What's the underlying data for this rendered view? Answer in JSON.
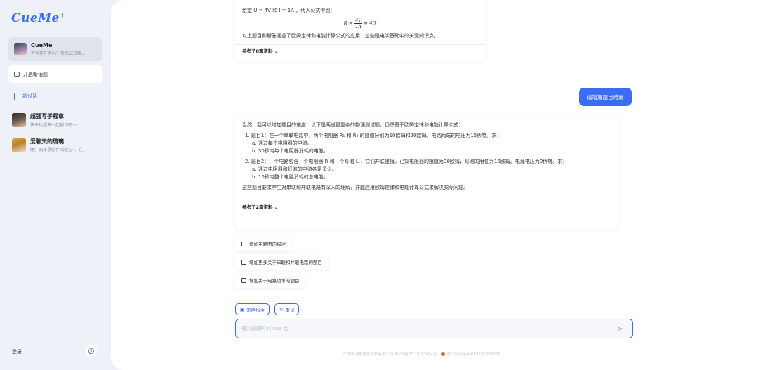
{
  "sidebar": {
    "logo": "CueMe",
    "logo_plus": "+",
    "active_agent": {
      "name": "CueMe",
      "desc": "有写作任务吗？快来试试我..."
    },
    "new_chat_label": "开启新话题",
    "new_conversation_label": "新对话",
    "agents": [
      {
        "name": "超强写手程章",
        "desc": "快来找程章一起创作吧～"
      },
      {
        "name": "爱聊天的琉璃",
        "desc": "嘿？刚才是你在叫我么～（..."
      }
    ],
    "login_label": "登录",
    "info_icon": "ⓘ"
  },
  "chat": {
    "msg1": {
      "top_line": "给定 U = 4V 和 I = 1A ，代入公式得到：",
      "formula_lhs": "R =",
      "formula_num": "4V",
      "formula_den": "1A",
      "formula_rhs": "= 4Ω",
      "summary": "以上题目和解答涵盖了欧姆定律和电能计算公式的应用，这些是电学基础中的关键知识点。",
      "ref": "参考了8篇资料 ⌄"
    },
    "user_msg": "请增加题目难度",
    "msg2": {
      "intro": "当然，我可以增加题目的难度，以下是两道更复杂的物理测试题，仍然基于欧姆定律和电能计算公式：",
      "q1": "1. 题目1：在一个串联电路中，两个电阻器 R₁ 和 R₂ 的阻值分别为10欧姆和20欧姆。电路两端的电压为15伏特。求：",
      "q1a": "a. 通过每个电阻器的电流。",
      "q1b": "b. 30秒内每个电阻器消耗的电能。",
      "q2": "2. 题目2：一个电路包含一个电阻器 R 和一个灯泡 L ，它们并联连接。已知电阻器的阻值为30欧姆，灯泡的阻值为15欧姆。电源电压为9伏特。求：",
      "q2a": "a. 通过电阻器和灯泡的电流各是多少。",
      "q2b": "b. 10秒内整个电路消耗的总电能。",
      "summary": "这些题目要求学生对串联和并联电路有深入的理解，并能应用欧姆定律和电能计算公式来解决实际问题。",
      "ref": "参考了2篇资料 ⌄"
    },
    "suggestions": [
      "增加电路图的描述",
      "增加更多关于串联和并联电路的题目",
      "增加关于电路功率的题目"
    ]
  },
  "toolbar": {
    "commands_label": "常用指令",
    "retry_label": "重试"
  },
  "input": {
    "placeholder": "有问题随时问 cue 我"
  },
  "footer": {
    "left": "广州市动悦信息技术有限公司 粤ICP备2022013084号",
    "right": "粤公网安备44010502003355"
  }
}
